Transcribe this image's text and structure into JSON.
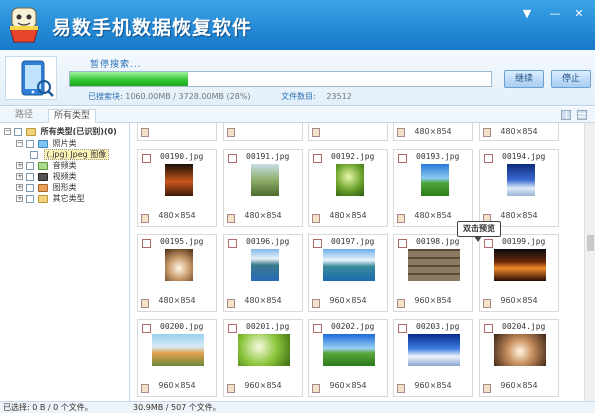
{
  "app": {
    "title": "易数手机数据恢复软件"
  },
  "window_controls": {
    "menu": "▼",
    "minimize": "—",
    "close": "✕"
  },
  "scan": {
    "status": "暂停搜索...",
    "progress": 0.28,
    "continue_label": "继续",
    "stop_label": "停止",
    "searched_label": "已搜索块:",
    "searched_value": "1060.00MB / 3728.00MB (28%)",
    "files_label": "文件数目:",
    "files_value": "23512"
  },
  "tabs": {
    "path": "路径",
    "all_types": "所有类型"
  },
  "tree": {
    "root": "所有类型(已识别)(0)",
    "photos": "照片类",
    "jpeg": "(.jpg) Jpeg 图像",
    "audio": "音频类",
    "video": "视频类",
    "graphics": "图形类",
    "other": "其它类型"
  },
  "top_row": [
    "",
    "",
    "",
    "480×854",
    "480×854"
  ],
  "rows": [
    [
      {
        "name": "00190.jpg",
        "dims": "480×854"
      },
      {
        "name": "00191.jpg",
        "dims": "480×854"
      },
      {
        "name": "00192.jpg",
        "dims": "480×854"
      },
      {
        "name": "00193.jpg",
        "dims": "480×854"
      },
      {
        "name": "00194.jpg",
        "dims": "480×854"
      }
    ],
    [
      {
        "name": "00195.jpg",
        "dims": "480×854"
      },
      {
        "name": "00196.jpg",
        "dims": "480×854"
      },
      {
        "name": "00197.jpg",
        "dims": "960×854"
      },
      {
        "name": "00198.jpg",
        "dims": "960×854"
      },
      {
        "name": "00199.jpg",
        "dims": "960×854"
      }
    ],
    [
      {
        "name": "00200.jpg",
        "dims": "960×854"
      },
      {
        "name": "00201.jpg",
        "dims": "960×854"
      },
      {
        "name": "00202.jpg",
        "dims": "960×854"
      },
      {
        "name": "00203.jpg",
        "dims": "960×854"
      },
      {
        "name": "00204.jpg",
        "dims": "960×854"
      }
    ]
  ],
  "tooltip": "双击预览",
  "status": {
    "selected": "已选择: 0 B / 0 个文件。",
    "total": "30.9MB / 507 个文件。"
  }
}
